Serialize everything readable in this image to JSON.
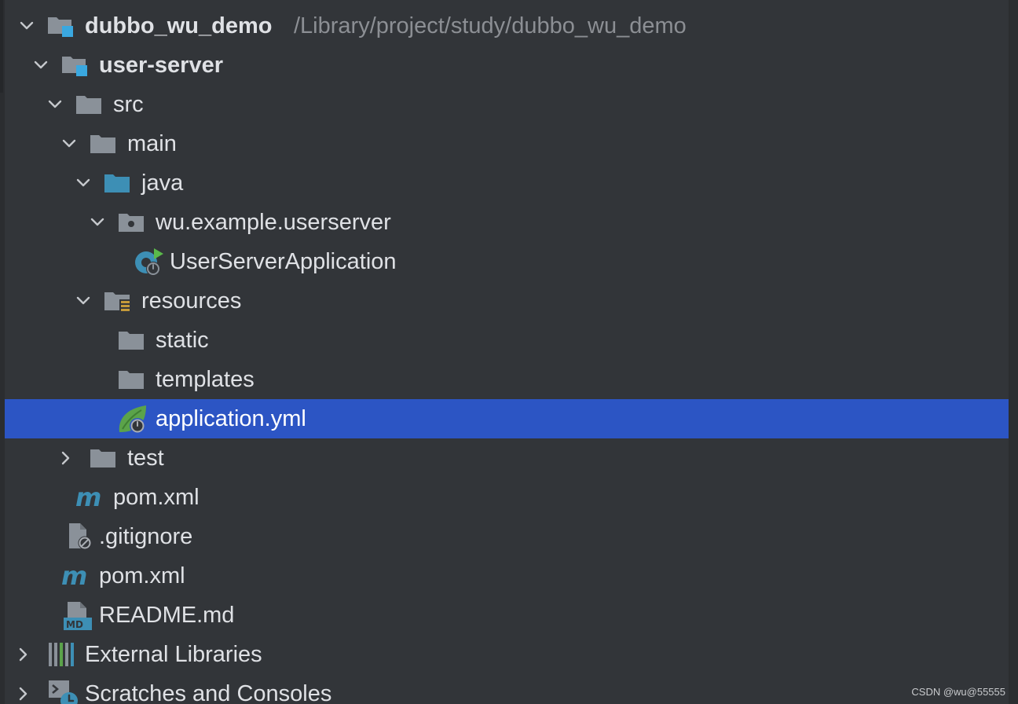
{
  "tree": {
    "items": [
      {
        "label": "dubbo_wu_demo",
        "path": "/Library/project/study/dubbo_wu_demo"
      },
      {
        "label": "user-server"
      },
      {
        "label": "src"
      },
      {
        "label": "main"
      },
      {
        "label": "java"
      },
      {
        "label": "wu.example.userserver"
      },
      {
        "label": "UserServerApplication"
      },
      {
        "label": "resources"
      },
      {
        "label": "static"
      },
      {
        "label": "templates"
      },
      {
        "label": "application.yml"
      },
      {
        "label": "test"
      },
      {
        "label": "pom.xml"
      },
      {
        "label": ".gitignore"
      },
      {
        "label": "pom.xml"
      },
      {
        "label": "README.md"
      },
      {
        "label": "External Libraries"
      },
      {
        "label": "Scratches and Consoles"
      }
    ]
  },
  "watermark": "CSDN @wu@55555",
  "colors": {
    "background": "#323539",
    "selection": "#2c55c4",
    "text": "#dfe1e5",
    "path": "#8c8f94",
    "folder": "#8a9199",
    "java_folder": "#3d8fb5",
    "module_badge": "#3aa8e0",
    "maven": "#3d8fb5",
    "spring": "#5ba34a"
  }
}
